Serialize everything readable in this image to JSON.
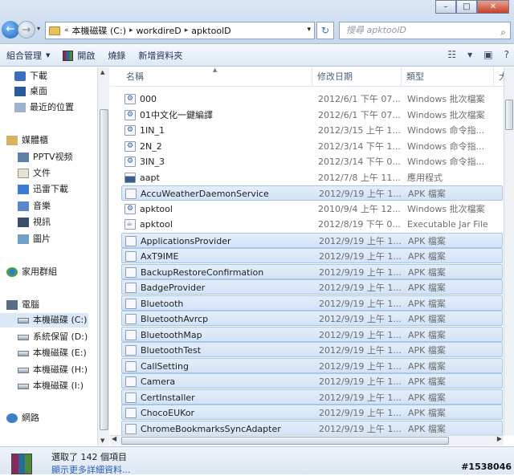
{
  "window": {
    "minimize": "–",
    "maximize": "□",
    "close": "✕"
  },
  "nav": {
    "back": "←",
    "forward": "→",
    "dropdown": "▾"
  },
  "address": {
    "prefix": "«",
    "crumbs": [
      "本機磁碟 (C:)",
      "workdireD",
      "apktoolD"
    ],
    "separator": "▸"
  },
  "search": {
    "placeholder": "搜尋 apktoolD"
  },
  "toolbar": {
    "organize": "組合管理",
    "open": "開啟",
    "burn": "燒錄",
    "new_folder": "新增資料夾"
  },
  "sidebar": [
    {
      "label": "下載",
      "icon": "ni-down"
    },
    {
      "label": "桌面",
      "icon": "ni-desk"
    },
    {
      "label": "最近的位置",
      "icon": "ni-recent"
    },
    {
      "label": "媒體櫃",
      "icon": "ni-lib"
    },
    {
      "label": "PPTV视频",
      "icon": "ni-video"
    },
    {
      "label": "文件",
      "icon": "ni-doc"
    },
    {
      "label": "迅雷下載",
      "icon": "ni-thunder"
    },
    {
      "label": "音樂",
      "icon": "ni-music"
    },
    {
      "label": "視訊",
      "icon": "ni-film"
    },
    {
      "label": "圖片",
      "icon": "ni-pic"
    },
    {
      "label": "家用群組",
      "icon": "ni-home"
    },
    {
      "label": "電腦",
      "icon": "ni-pc"
    },
    {
      "label": "本機磁碟 (C:)",
      "icon": "ni-drive",
      "selected": true
    },
    {
      "label": "系統保留 (D:)",
      "icon": "ni-drive"
    },
    {
      "label": "本機磁碟 (E:)",
      "icon": "ni-drive"
    },
    {
      "label": "本機磁碟 (H:)",
      "icon": "ni-drive"
    },
    {
      "label": "本機磁碟 (I:)",
      "icon": "ni-drive"
    },
    {
      "label": "網路",
      "icon": "ni-net"
    }
  ],
  "columns": {
    "name": "名稱",
    "date": "修改日期",
    "type": "類型",
    "size": "大"
  },
  "files": [
    {
      "name": "000",
      "date": "2012/6/1 下午 07...",
      "type": "Windows 批次檔案",
      "icon": "bat",
      "selected": false
    },
    {
      "name": "01中文化一鍵編譯",
      "date": "2012/6/1 下午 07...",
      "type": "Windows 批次檔案",
      "icon": "bat",
      "selected": false
    },
    {
      "name": "1IN_1",
      "date": "2012/3/15 上午 1...",
      "type": "Windows 命令指...",
      "icon": "bat",
      "selected": false
    },
    {
      "name": "2N_2",
      "date": "2012/3/14 下午 1...",
      "type": "Windows 命令指...",
      "icon": "bat",
      "selected": false
    },
    {
      "name": "3IN_3",
      "date": "2012/3/14 下午 0...",
      "type": "Windows 命令指...",
      "icon": "bat",
      "selected": false
    },
    {
      "name": "aapt",
      "date": "2012/7/8 上午 11...",
      "type": "應用程式",
      "icon": "exe",
      "selected": false
    },
    {
      "name": "AccuWeatherDaemonService",
      "date": "2012/9/19 上午 1...",
      "type": "APK 檔案",
      "icon": "apk",
      "selected": true
    },
    {
      "name": "apktool",
      "date": "2010/9/4 上午 12...",
      "type": "Windows 批次檔案",
      "icon": "bat",
      "selected": false
    },
    {
      "name": "apktool",
      "date": "2012/8/19 下午 0...",
      "type": "Executable Jar File",
      "icon": "jar",
      "selected": false
    },
    {
      "name": "ApplicationsProvider",
      "date": "2012/9/19 上午 1...",
      "type": "APK 檔案",
      "icon": "apk",
      "selected": true
    },
    {
      "name": "AxT9IME",
      "date": "2012/9/19 上午 1...",
      "type": "APK 檔案",
      "icon": "apk",
      "selected": true
    },
    {
      "name": "BackupRestoreConfirmation",
      "date": "2012/9/19 上午 1...",
      "type": "APK 檔案",
      "icon": "apk",
      "selected": true
    },
    {
      "name": "BadgeProvider",
      "date": "2012/9/19 上午 1...",
      "type": "APK 檔案",
      "icon": "apk",
      "selected": true
    },
    {
      "name": "Bluetooth",
      "date": "2012/9/19 上午 1...",
      "type": "APK 檔案",
      "icon": "apk",
      "selected": true
    },
    {
      "name": "BluetoothAvrcp",
      "date": "2012/9/19 上午 1...",
      "type": "APK 檔案",
      "icon": "apk",
      "selected": true
    },
    {
      "name": "BluetoothMap",
      "date": "2012/9/19 上午 1...",
      "type": "APK 檔案",
      "icon": "apk",
      "selected": true
    },
    {
      "name": "BluetoothTest",
      "date": "2012/9/19 上午 1...",
      "type": "APK 檔案",
      "icon": "apk",
      "selected": true
    },
    {
      "name": "CallSetting",
      "date": "2012/9/19 上午 1...",
      "type": "APK 檔案",
      "icon": "apk",
      "selected": true
    },
    {
      "name": "Camera",
      "date": "2012/9/19 上午 1...",
      "type": "APK 檔案",
      "icon": "apk",
      "selected": true
    },
    {
      "name": "CertInstaller",
      "date": "2012/9/19 上午 1...",
      "type": "APK 檔案",
      "icon": "apk",
      "selected": true
    },
    {
      "name": "ChocoEUKor",
      "date": "2012/9/19 上午 1...",
      "type": "APK 檔案",
      "icon": "apk",
      "selected": true
    },
    {
      "name": "ChromeBookmarksSyncAdapter",
      "date": "2012/9/19 上午 1...",
      "type": "APK 檔案",
      "icon": "apk",
      "selected": true
    }
  ],
  "status": {
    "selected": "選取了 142 個項目",
    "details_link": "顯示更多詳細資料..."
  },
  "watermark": "#1538046"
}
